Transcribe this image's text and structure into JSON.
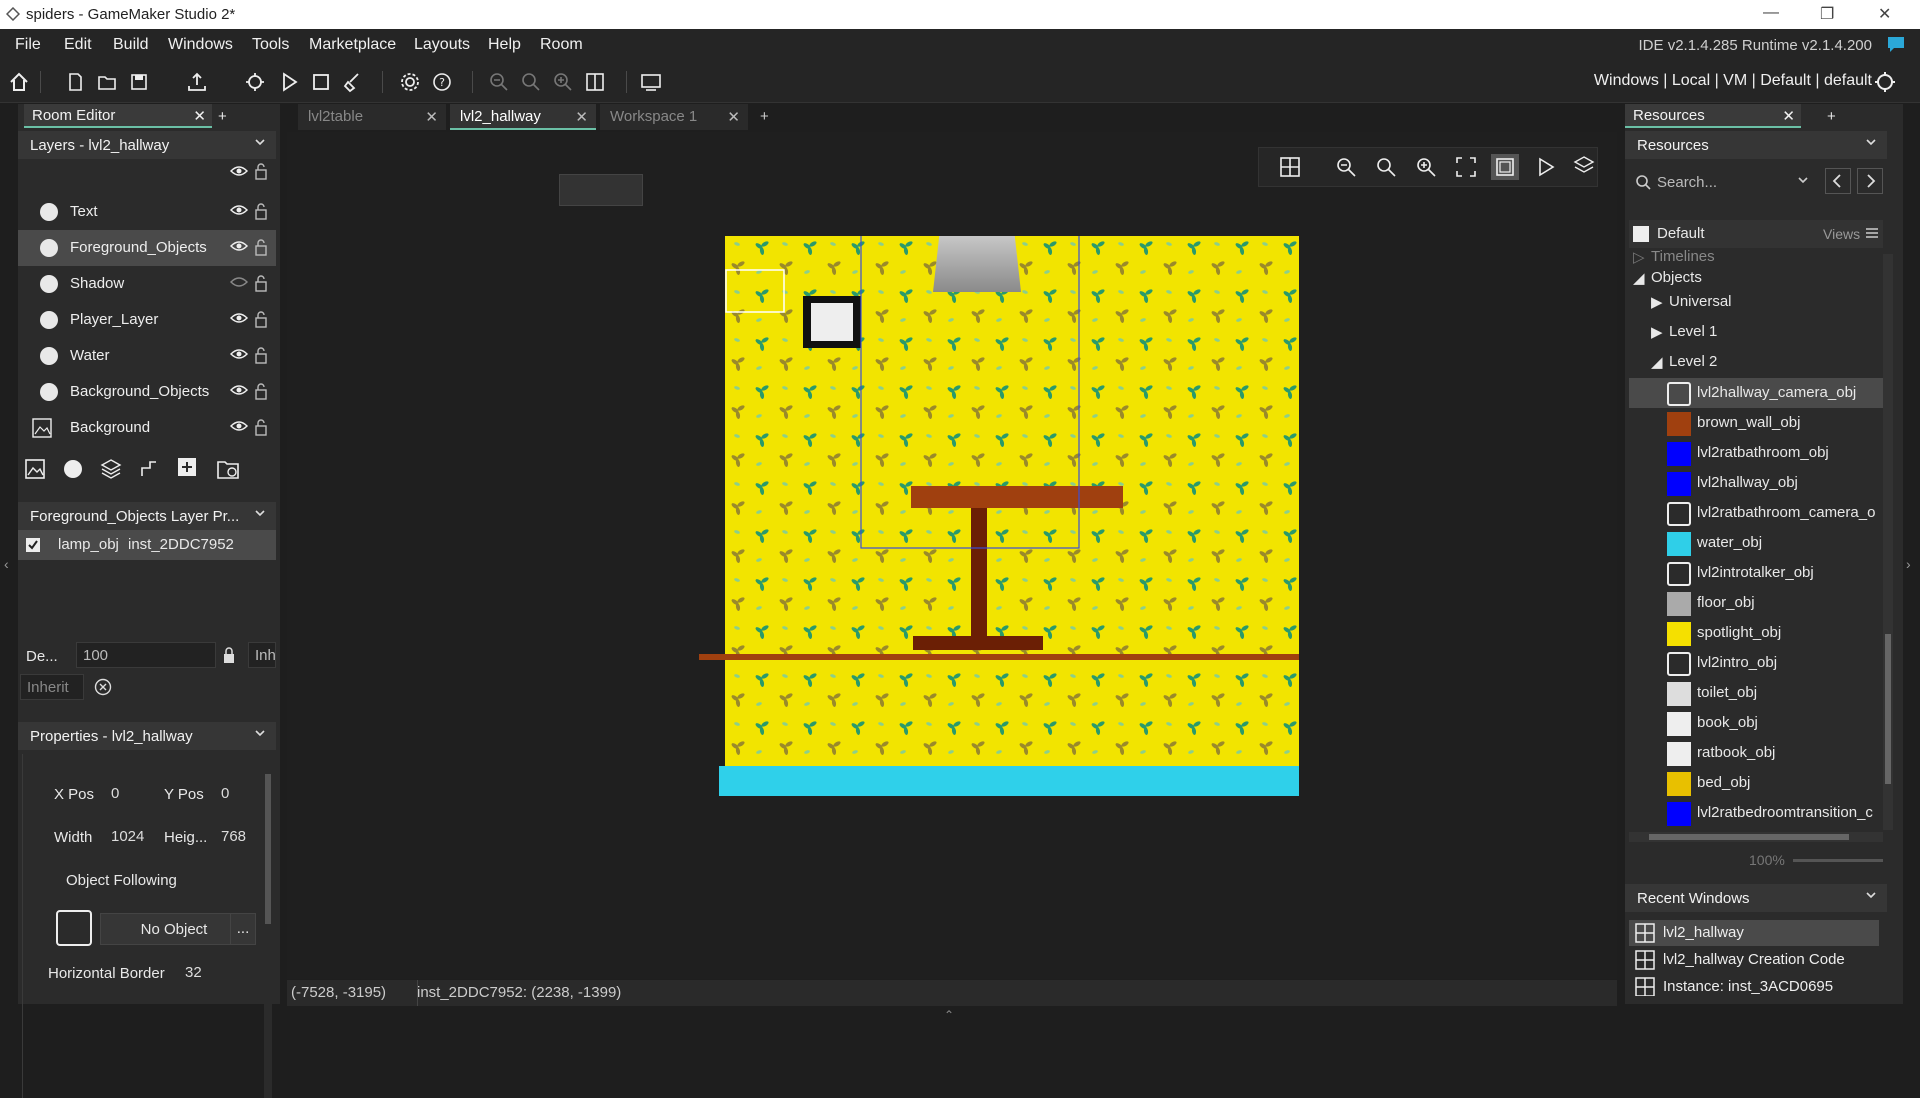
{
  "window": {
    "title": "spiders - GameMaker Studio 2*"
  },
  "menu": {
    "items": [
      "File",
      "Edit",
      "Build",
      "Windows",
      "Tools",
      "Marketplace",
      "Layouts",
      "Help",
      "Room"
    ],
    "version": "IDE v2.1.4.285 Runtime v2.1.4.200"
  },
  "toolbar": {
    "target": "Windows | Local | VM | Default | default"
  },
  "left": {
    "tab": "Room Editor",
    "layers_title": "Layers - lvl2_hallway",
    "layers": [
      "Text",
      "Foreground_Objects",
      "Shadow",
      "Player_Layer",
      "Water",
      "Background_Objects",
      "Background"
    ],
    "layer_props_title": "Foreground_Objects Layer Pr...",
    "instance": {
      "name": "lamp_obj",
      "id": "inst_2DDC7952"
    },
    "depth_label": "De...",
    "depth_value": "100",
    "inherit_short": "Inh",
    "inherit_label": "Inherit",
    "properties_title": "Properties - lvl2_hallway",
    "xpos_label": "X Pos",
    "xpos": "0",
    "ypos_label": "Y Pos",
    "ypos": "0",
    "width_label": "Width",
    "width": "1024",
    "height_label": "Heig...",
    "height": "768",
    "object_following_label": "Object Following",
    "no_object": "No Object",
    "more": "...",
    "hborder_label": "Horizontal Border",
    "hborder": "32"
  },
  "tabs": [
    {
      "label": "lvl2table"
    },
    {
      "label": "lvl2_hallway"
    },
    {
      "label": "Workspace 1"
    }
  ],
  "status": {
    "cursor": "(-7528, -3195)",
    "instance": "inst_2DDC7952: (2238, -1399)"
  },
  "right": {
    "tab": "Resources",
    "header": "Resources",
    "search_placeholder": "Search...",
    "group": "Default",
    "views_label": "Views",
    "timelines": "Timelines",
    "objects": "Objects",
    "folders": [
      "Universal",
      "Level 1",
      "Level 2"
    ],
    "items": [
      {
        "name": "lvl2hallway_camera_obj",
        "swatch": "frame"
      },
      {
        "name": "brown_wall_obj",
        "swatch": "#a0400f"
      },
      {
        "name": "lvl2ratbathroom_obj",
        "swatch": "#0000ff"
      },
      {
        "name": "lvl2hallway_obj",
        "swatch": "#0000ff"
      },
      {
        "name": "lvl2ratbathroom_camera_o",
        "swatch": "frame"
      },
      {
        "name": "water_obj",
        "swatch": "#2fcfe8"
      },
      {
        "name": "lvl2introtalker_obj",
        "swatch": "frame"
      },
      {
        "name": "floor_obj",
        "swatch": "#aaaaaa"
      },
      {
        "name": "spotlight_obj",
        "swatch": "#f5e000"
      },
      {
        "name": "lvl2intro_obj",
        "swatch": "frame"
      },
      {
        "name": "toilet_obj",
        "swatch": "#dddddd"
      },
      {
        "name": "book_obj",
        "swatch": "#eeeeee"
      },
      {
        "name": "ratbook_obj",
        "swatch": "#eeeeee"
      },
      {
        "name": "bed_obj",
        "swatch": "#e8c000"
      },
      {
        "name": "lvl2ratbedroomtransition_c",
        "swatch": "#0000ff"
      }
    ],
    "zoom": "100%",
    "recent_title": "Recent Windows",
    "recent": [
      "lvl2_hallway",
      "lvl2_hallway Creation Code",
      "Instance: inst_3ACD0695"
    ]
  }
}
